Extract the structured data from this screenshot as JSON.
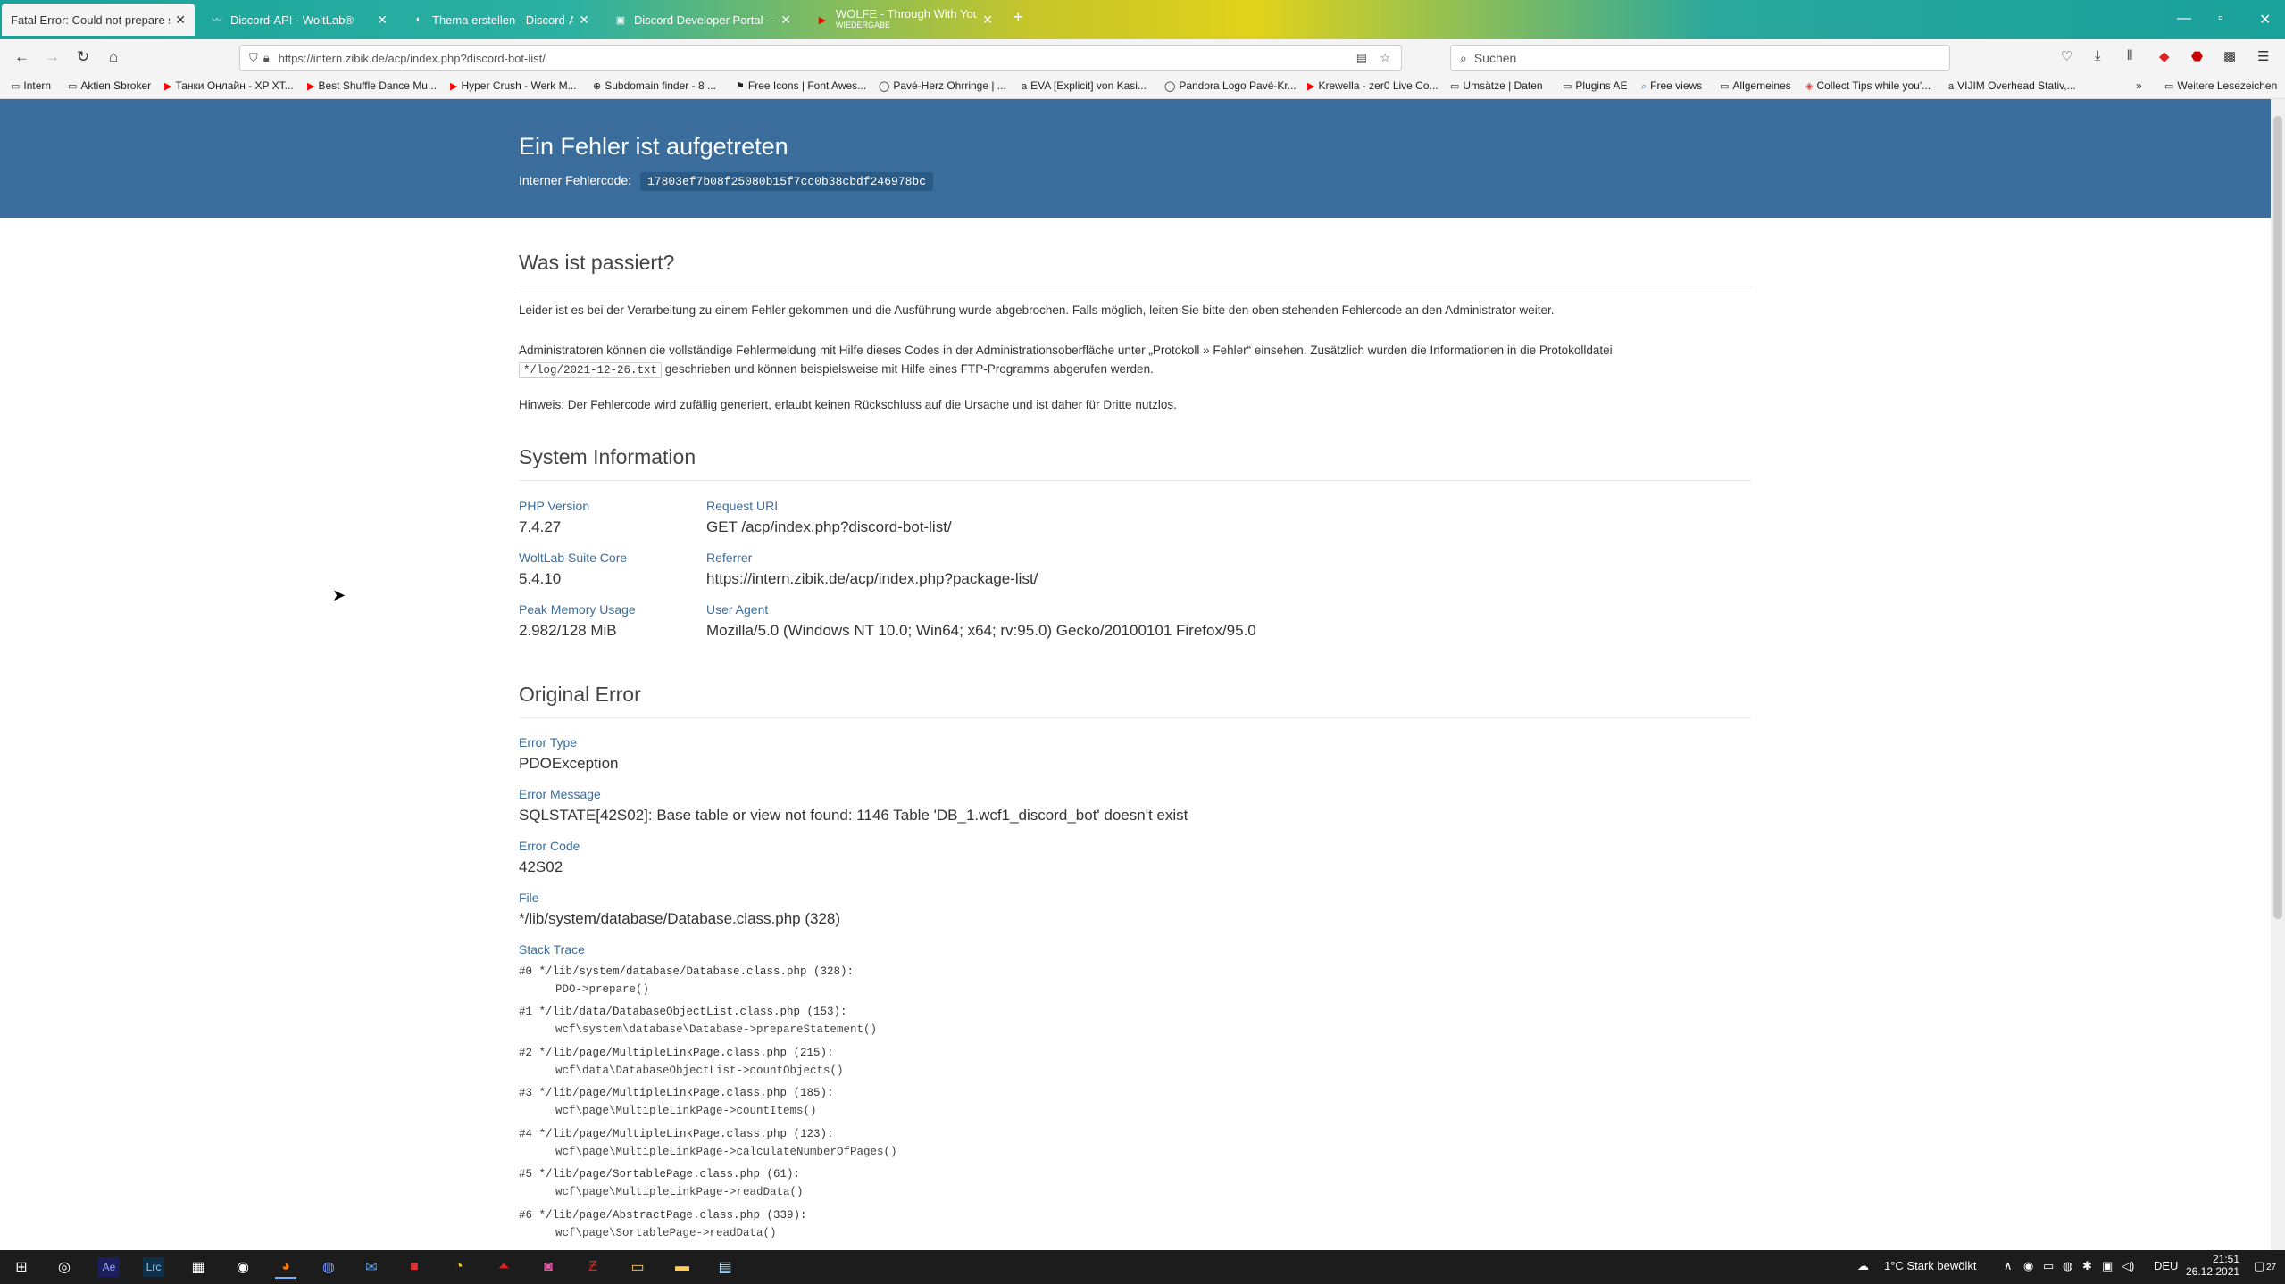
{
  "browser": {
    "tabs": [
      {
        "title": "Fatal Error: Could not prepare statem",
        "favicon": "page-icon",
        "active": true
      },
      {
        "title": "Discord-API - WoltLab®",
        "favicon": "woltlab-icon"
      },
      {
        "title": "Thema erstellen - Discord-API",
        "favicon": "woltlab-icon"
      },
      {
        "title": "Discord Developer Portal — My",
        "favicon": "discord-icon"
      },
      {
        "title": "WOLFE - Through With You -",
        "subtitle": "WIEDERGABE",
        "favicon": "youtube-icon"
      }
    ],
    "url": "https://intern.zibik.de/acp/index.php?discord-bot-list/",
    "search_placeholder": "Suchen",
    "bookmarks": [
      {
        "label": "Intern",
        "icon": "folder-icon"
      },
      {
        "label": "Aktien Sbroker",
        "icon": "folder-icon"
      },
      {
        "label": "Танки Онлайн - XP XT...",
        "icon": "youtube-icon"
      },
      {
        "label": "Best Shuffle Dance Mu...",
        "icon": "youtube-icon"
      },
      {
        "label": "Hyper Crush - Werk M...",
        "icon": "youtube-icon"
      },
      {
        "label": "Subdomain finder - 8 ...",
        "icon": "globe-icon"
      },
      {
        "label": "Free Icons | Font Awes...",
        "icon": "flag-icon"
      },
      {
        "label": "Pavé-Herz Ohrringe | ...",
        "icon": "circle-icon"
      },
      {
        "label": "EVA [Explicit] von Kasi...",
        "icon": "amazon-icon"
      },
      {
        "label": "Pandora Logo Pavé-Kr...",
        "icon": "circle-icon"
      },
      {
        "label": "Krewella - zer0 Live Co...",
        "icon": "youtube-icon"
      },
      {
        "label": "Umsätze | Daten",
        "icon": "folder-icon"
      },
      {
        "label": "Plugins AE",
        "icon": "folder-icon"
      },
      {
        "label": "Free views",
        "icon": "search-icon"
      },
      {
        "label": "Allgemeines",
        "icon": "folder-icon"
      },
      {
        "label": "Collect Tips while you'...",
        "icon": "link-icon"
      },
      {
        "label": "VIJIM Overhead Stativ,...",
        "icon": "amazon-icon"
      }
    ],
    "more_bookmarks": "Weitere Lesezeichen"
  },
  "header": {
    "title": "Ein Fehler ist aufgetreten",
    "code_label": "Interner Fehlercode:",
    "code": "17803ef7b08f25080b15f7cc0b38cbdf246978bc"
  },
  "what_happened": {
    "title": "Was ist passiert?",
    "p1": "Leider ist es bei der Verarbeitung zu einem Fehler gekommen und die Ausführung wurde abgebrochen. Falls möglich, leiten Sie bitte den oben stehenden Fehlercode an den Administrator weiter.",
    "p2a": "Administratoren können die vollständige Fehlermeldung mit Hilfe dieses Codes in der Administrationsoberfläche unter „Protokoll » Fehler“ einsehen. Zusätzlich wurden die Informationen in die Protokolldatei",
    "p2_file": "*/log/2021-12-26.txt",
    "p2b": "geschrieben und können beispielsweise mit Hilfe eines FTP-Programms abgerufen werden.",
    "p3": "Hinweis: Der Fehlercode wird zufällig generiert, erlaubt keinen Rückschluss auf die Ursache und ist daher für Dritte nutzlos."
  },
  "system_info": {
    "title": "System Information",
    "php_label": "PHP Version",
    "php": "7.4.27",
    "wsc_label": "WoltLab Suite Core",
    "wsc": "5.4.10",
    "mem_label": "Peak Memory Usage",
    "mem": "2.982/128 MiB",
    "uri_label": "Request URI",
    "uri": "GET /acp/index.php?discord-bot-list/",
    "ref_label": "Referrer",
    "ref": "https://intern.zibik.de/acp/index.php?package-list/",
    "ua_label": "User Agent",
    "ua": "Mozilla/5.0 (Windows NT 10.0; Win64; x64; rv:95.0) Gecko/20100101 Firefox/95.0"
  },
  "original_error": {
    "title": "Original Error",
    "type_label": "Error Type",
    "type": "PDOException",
    "msg_label": "Error Message",
    "msg": "SQLSTATE[42S02]: Base table or view not found: 1146 Table 'DB_1.wcf1_discord_bot' doesn't exist",
    "code_label": "Error Code",
    "code": "42S02",
    "file_label": "File",
    "file": "*/lib/system/database/Database.class.php (328)",
    "trace_label": "Stack Trace",
    "trace": [
      {
        "line": "#0 */lib/system/database/Database.class.php (328):",
        "call": "PDO->prepare()"
      },
      {
        "line": "#1 */lib/data/DatabaseObjectList.class.php (153):",
        "call": "wcf\\system\\database\\Database->prepareStatement()"
      },
      {
        "line": "#2 */lib/page/MultipleLinkPage.class.php (215):",
        "call": "wcf\\data\\DatabaseObjectList->countObjects()"
      },
      {
        "line": "#3 */lib/page/MultipleLinkPage.class.php (185):",
        "call": "wcf\\page\\MultipleLinkPage->countItems()"
      },
      {
        "line": "#4 */lib/page/MultipleLinkPage.class.php (123):",
        "call": "wcf\\page\\MultipleLinkPage->calculateNumberOfPages()"
      },
      {
        "line": "#5 */lib/page/SortablePage.class.php (61):",
        "call": "wcf\\page\\MultipleLinkPage->readData()"
      },
      {
        "line": "#6 */lib/page/AbstractPage.class.php (339):",
        "call": "wcf\\page\\SortablePage->readData()"
      }
    ]
  },
  "taskbar": {
    "weather": "1°C  Stark bewölkt",
    "lang": "DEU",
    "time": "21:51",
    "date": "26.12.2021",
    "notifications": "27"
  }
}
